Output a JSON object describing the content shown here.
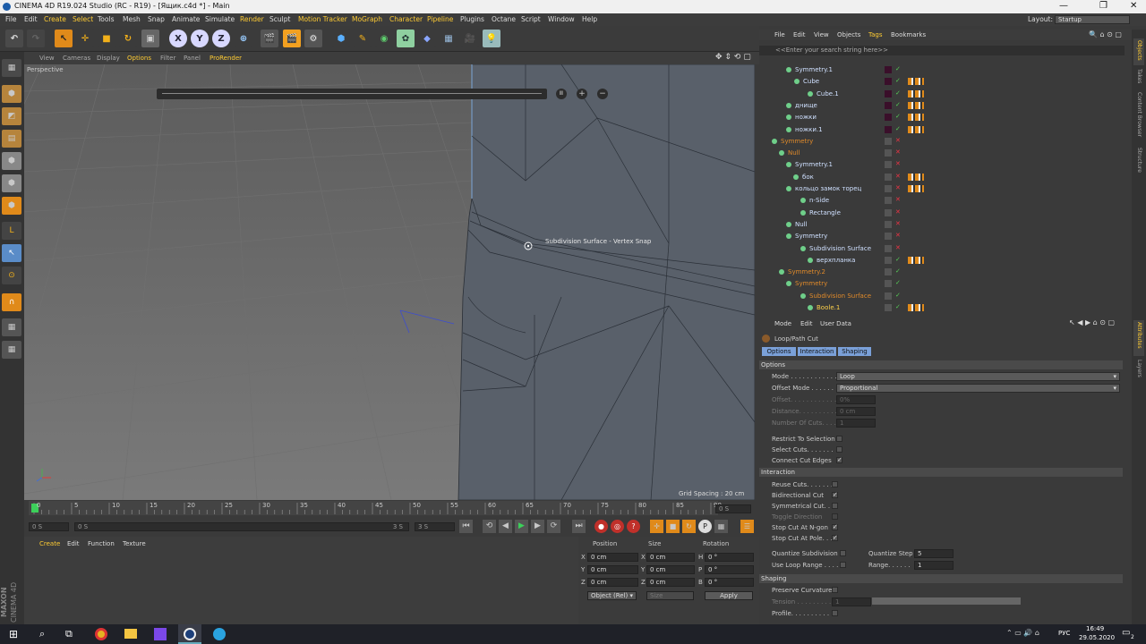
{
  "app": {
    "title": "CINEMA 4D R19.024 Studio (RC - R19) - [Ящик.c4d *] - Main",
    "layout_label": "Layout:",
    "layout_value": "Startup"
  },
  "menu": [
    "File",
    "Edit",
    "Create",
    "Select",
    "Tools",
    "Mesh",
    "Snap",
    "Animate",
    "Simulate",
    "Render",
    "Sculpt",
    "Motion Tracker",
    "MoGraph",
    "Character",
    "Pipeline",
    "Plugins",
    "Octane",
    "Script",
    "Window",
    "Help"
  ],
  "toolbar": {
    "axis_x": "X",
    "axis_y": "Y",
    "axis_z": "Z"
  },
  "viewport": {
    "menu": [
      "View",
      "Cameras",
      "Display",
      "Options",
      "Filter",
      "Panel",
      "ProRender"
    ],
    "label": "Perspective",
    "tooltip": "Subdivision Surface - Vertex Snap",
    "grid_spacing": "Grid Spacing : 20 cm"
  },
  "timeline": {
    "ticks": [
      "0",
      "5",
      "10",
      "15",
      "20",
      "25",
      "30",
      "35",
      "40",
      "45",
      "50",
      "55",
      "60",
      "65",
      "70",
      "75",
      "80",
      "85",
      "90"
    ],
    "frame_end_display": "0 S",
    "start": "0 S",
    "range_start": "0 S",
    "range_end": "3 S",
    "current": "3 S"
  },
  "material": {
    "menu": [
      "Create",
      "Edit",
      "Function",
      "Texture"
    ],
    "brand1": "MAXON",
    "brand2": "CINEMA 4D"
  },
  "coords": {
    "headers": [
      "Position",
      "Size",
      "Rotation"
    ],
    "rows": [
      {
        "axis": "X",
        "pos": "0 cm",
        "saxis": "X",
        "size": "0 cm",
        "raxis": "H",
        "rot": "0 °"
      },
      {
        "axis": "Y",
        "pos": "0 cm",
        "saxis": "Y",
        "size": "0 cm",
        "raxis": "P",
        "rot": "0 °"
      },
      {
        "axis": "Z",
        "pos": "0 cm",
        "saxis": "Z",
        "size": "0 cm",
        "raxis": "B",
        "rot": "0 °"
      }
    ],
    "mode": "Object (Rel)",
    "size_mode": "Size",
    "apply": "Apply"
  },
  "objects": {
    "menu": [
      "File",
      "Edit",
      "View",
      "Objects",
      "Tags",
      "Bookmarks"
    ],
    "search_placeholder": "<<Enter your search string here>>",
    "items": [
      {
        "name": "Symmetry.1",
        "color": "#cfe0ff"
      },
      {
        "name": "Cube",
        "color": "#cfe0ff"
      },
      {
        "name": "Cube.1",
        "color": "#cfe0ff"
      },
      {
        "name": "днище",
        "color": "#cfe0ff"
      },
      {
        "name": "ножки",
        "color": "#cfe0ff"
      },
      {
        "name": "ножки.1",
        "color": "#cfe0ff"
      },
      {
        "name": "Symmetry",
        "color": "#e08a2a"
      },
      {
        "name": "Null",
        "color": "#e08a2a"
      },
      {
        "name": "Symmetry.1",
        "color": "#cfe0ff"
      },
      {
        "name": "бок",
        "color": "#cfe0ff"
      },
      {
        "name": "кольцо замок торец",
        "color": "#cfe0ff"
      },
      {
        "name": "n-Side",
        "color": "#cfe0ff"
      },
      {
        "name": "Rectangle",
        "color": "#cfe0ff"
      },
      {
        "name": "Null",
        "color": "#cfe0ff"
      },
      {
        "name": "Symmetry",
        "color": "#cfe0ff"
      },
      {
        "name": "Subdivision Surface",
        "color": "#cfe0ff"
      },
      {
        "name": "верхпланка",
        "color": "#cfe0ff"
      },
      {
        "name": "Symmetry.2",
        "color": "#e08a2a"
      },
      {
        "name": "Symmetry",
        "color": "#e08a2a"
      },
      {
        "name": "Subdivision Surface",
        "color": "#e08a2a"
      },
      {
        "name": "Boole.1",
        "color": "#ffd24a"
      }
    ]
  },
  "attributes": {
    "menu": [
      "Mode",
      "Edit",
      "User Data"
    ],
    "tool_name": "Loop/Path Cut",
    "tabs": [
      "Options",
      "Interaction",
      "Shaping"
    ],
    "sections": {
      "options": "Options",
      "interaction": "Interaction",
      "shaping": "Shaping"
    },
    "mode_label": "Mode . . . . . . . . . . . . .",
    "mode_value": "Loop",
    "offset_mode_label": "Offset Mode . . . . . . .",
    "offset_mode_value": "Proportional",
    "offset_label": "Offset. . . . . . . . . . . .",
    "offset_value": "0%",
    "distance_label": "Distance. . . . . . . . . .",
    "distance_value": "0 cm",
    "cuts_label": "Number Of Cuts. . . . .",
    "cuts_value": "1",
    "restrict": "Restrict To Selection",
    "select_cuts": "Select Cuts. . . . . . .",
    "connect": "Connect Cut Edges",
    "reuse": "Reuse Cuts. . . . . . . .",
    "bidir": "Bidirectional Cut",
    "symm": "Symmetrical Cut. . . .",
    "toggle": "Toggle Direction",
    "stop_ngon": "Stop Cut At N-gon",
    "stop_pole": "Stop Cut At Pole. . .",
    "quantize": "Quantize Subdivision",
    "quant_step_label": "Quantize Step",
    "quant_step": "5",
    "use_loop": "Use Loop Range . . . .",
    "range_label": "Range. . . . . .",
    "range_value": "1",
    "preserve": "Preserve Curvature",
    "tension_label": "Tension . . . . . . . . .",
    "tension_value": "1",
    "profile": "Profile. . . . . . . . . . ."
  },
  "right_tabs": [
    "Objects",
    "Takes",
    "Content Browser",
    "Structure",
    "Attributes",
    "Layers"
  ],
  "taskbar": {
    "lang": "РУС",
    "time": "16:49",
    "date": "29.05.2020",
    "notif": "2"
  }
}
